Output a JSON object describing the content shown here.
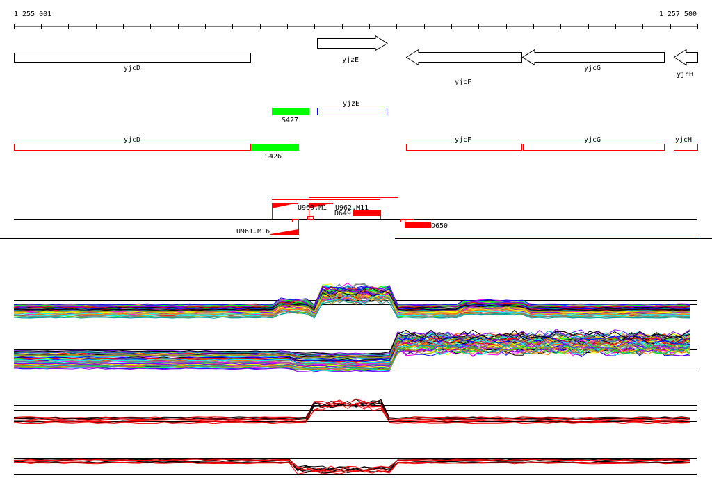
{
  "ruler": {
    "start_label": "1 255 001",
    "end_label": "1 257 500",
    "start": 1255001,
    "end": 1257500,
    "tick_step": 100
  },
  "genes": [
    {
      "name": "yjcD",
      "start": 1255001,
      "end": 1255865,
      "strand": "none"
    },
    {
      "name": "yjzE",
      "start": 1256110,
      "end": 1256365,
      "strand": "+"
    },
    {
      "name": "yjcF",
      "start": 1256435,
      "end": 1256858,
      "strand": "-"
    },
    {
      "name": "yjcG",
      "start": 1256860,
      "end": 1257380,
      "strand": "-"
    },
    {
      "name": "yjcH",
      "start": 1257415,
      "end": 1257500,
      "strand": "-"
    }
  ],
  "features_row2": [
    {
      "name": "S427",
      "color": "#00ff00"
    },
    {
      "name": "yjzE",
      "color": "#0000ff"
    }
  ],
  "features_row3": [
    {
      "name": "yjcD",
      "color": "#ff0000"
    },
    {
      "name": "S426",
      "color": "#00ff00"
    },
    {
      "name": "yjcF",
      "color": "#ff0000"
    },
    {
      "name": "yjcG",
      "color": "#ff0000"
    },
    {
      "name": "yjcH",
      "color": "#ff0000"
    }
  ],
  "transcripts": {
    "u960": "U960.M1",
    "u962": "U962.M11",
    "d649": "D649",
    "d650": "D650",
    "u961": "U961.M16"
  },
  "colors": {
    "accent_red": "#ff0000",
    "accent_green": "#00ff00",
    "accent_blue": "#0000ff",
    "trace_palette": [
      "#ff00ff",
      "#00ffff",
      "#ffff00",
      "#00ff00",
      "#ff0000",
      "#0000ff",
      "#ff8000",
      "#808080",
      "#000000",
      "#8000ff",
      "#00a0a0",
      "#a0a000"
    ]
  }
}
